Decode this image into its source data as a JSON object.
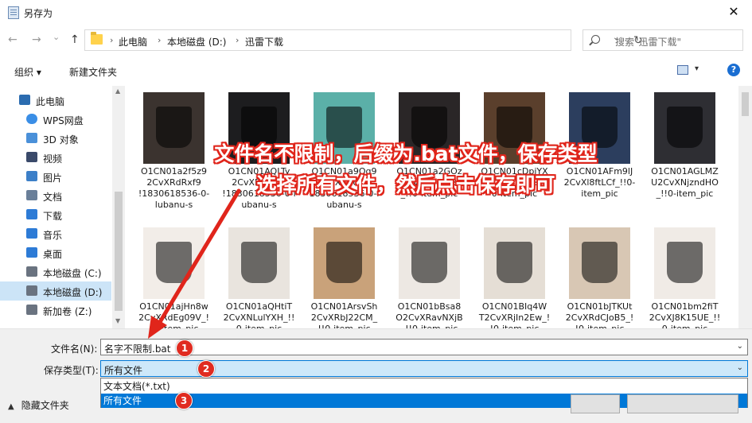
{
  "window": {
    "title": "另存为",
    "close_symbol": "✕"
  },
  "nav": {
    "back": "←",
    "forward": "→",
    "recent": "⌄",
    "up": "↑",
    "breadcrumbs": [
      "此电脑",
      "本地磁盘 (D:)",
      "迅雷下载"
    ],
    "separator": "›",
    "address_dropdown": "⌄",
    "refresh": "↻",
    "search_placeholder": "搜索\"迅雷下载\""
  },
  "toolbar": {
    "organize": "组织 ▾",
    "new_folder": "新建文件夹",
    "help": "?",
    "view_dropdown": "▾"
  },
  "sidebar": {
    "items": [
      {
        "label": "此电脑",
        "icon": "computer-icon",
        "color": "#2b6cb0"
      },
      {
        "label": "WPS网盘",
        "icon": "cloud-icon",
        "color": "#3a8ee6"
      },
      {
        "label": "3D 对象",
        "icon": "cube-icon",
        "color": "#4a90d9"
      },
      {
        "label": "视频",
        "icon": "video-icon",
        "color": "#3a4a6a"
      },
      {
        "label": "图片",
        "icon": "picture-icon",
        "color": "#3c7fc8"
      },
      {
        "label": "文档",
        "icon": "document-icon",
        "color": "#6a7f99"
      },
      {
        "label": "下载",
        "icon": "download-icon",
        "color": "#2d7bd6"
      },
      {
        "label": "音乐",
        "icon": "music-icon",
        "color": "#2d7bd6"
      },
      {
        "label": "桌面",
        "icon": "desktop-icon",
        "color": "#2d7bd6"
      },
      {
        "label": "本地磁盘 (C:)",
        "icon": "drive-icon",
        "color": "#6a7380"
      },
      {
        "label": "本地磁盘 (D:)",
        "icon": "drive-icon",
        "color": "#6a7380"
      },
      {
        "label": "新加卷 (Z:)",
        "icon": "drive-icon",
        "color": "#6a7380"
      }
    ],
    "selected_index": 10
  },
  "files": [
    {
      "caption": "O1CN01a2f5z9\n2CvXRdRxf9\n!1830618536-0-\nlubanu-s",
      "color": "#3b332f"
    },
    {
      "caption": "O1CN01AQLTy\n2CvXRcRqfX\n!1830618536-0-l\nubanu-s",
      "color": "#1d1d1f"
    },
    {
      "caption": "O1CN01a9Qg9\n2CvXPGoHY\n1830618536-0-l\nubanu-s",
      "color": "#5bb0a8"
    },
    {
      "caption": "O1CN01a2GOz\n2CvXRdaVtB\n_!!0-item_pic",
      "color": "#2a2627"
    },
    {
      "caption": "O1CN01cDpjYX\n2CvXRcG3Sc\n0-item_pic",
      "color": "#5a3f2c"
    },
    {
      "caption": "O1CN01AFm9lJ\n2CvXl8ftLCf_!!0-\nitem_pic",
      "color": "#2c3e5e"
    },
    {
      "caption": "O1CN01AGLMZ\nU2CvXNjzndHO\n_!!0-item_pic",
      "color": "#2e2e33"
    },
    {
      "caption": "O1CN01ajHn8w\n2CvXRdEg09V_!\n!0-item_pic",
      "color": "#f2ede8"
    },
    {
      "caption": "O1CN01aQHtiT\n2CvXNLulYXH_!!\n0-item_pic",
      "color": "#e9e4de"
    },
    {
      "caption": "O1CN01ArsvSh\n2CvXRbJ22CM_\n!!0-item_pic",
      "color": "#c9a27a"
    },
    {
      "caption": "O1CN01bBsa8\nO2CvXRavNXjB\n_!!0-item_pic",
      "color": "#ede8e3"
    },
    {
      "caption": "O1CN01BIq4W\nT2CvXRjIn2Ew_!\n!0-item_pic",
      "color": "#e5ded5"
    },
    {
      "caption": "O1CN01bJTKUt\n2CvXRdCJoB5_!\n!0-item_pic",
      "color": "#d8c7b4"
    },
    {
      "caption": "O1CN01bm2fiT\n2CvXJ8K15UE_!!\n0-item_pic",
      "color": "#f0ebe6"
    }
  ],
  "bottom": {
    "filename_label": "文件名(N):",
    "filename_value": "名字不限制.bat",
    "filetype_label": "保存类型(T):",
    "filetype_value": "所有文件",
    "options": [
      "文本文档(*.txt)",
      "所有文件"
    ],
    "selected_option": 1,
    "hide_folders": "隐藏文件夹",
    "dropdown_arrow": "⌄"
  },
  "annotation": {
    "line1": "文件名不限制，后缀为.bat文件，保存类型",
    "line2": "选择所有文件，然后点击保存即可",
    "badges": [
      "1",
      "2",
      "3"
    ],
    "color": "#e0251b"
  }
}
